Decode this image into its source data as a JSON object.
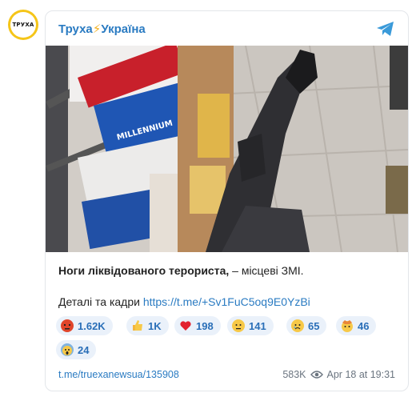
{
  "channel": {
    "avatar_text": "ТРУХА",
    "name_part1": "Труха",
    "name_bolt": "⚡",
    "name_part2": "Україна",
    "brand_color": "#2a7bc2",
    "avatar_color": "#f5c518"
  },
  "message": {
    "bold_text": "Ноги ліквідованого терориста,",
    "rest_text": " – місцеві ЗМІ.",
    "details_text": "Деталі та кадри ",
    "details_link": "https://t.me/+Sv1FuC5oq9E0YzBi"
  },
  "photo": {
    "box_brand": "MILLENNIUM"
  },
  "reactions": [
    {
      "icon": "angry-face-icon",
      "count": "1.62K"
    },
    {
      "icon": "thumbs-up-icon",
      "count": "1K"
    },
    {
      "icon": "red-heart-icon",
      "count": "198"
    },
    {
      "icon": "face-with-raised-eyebrow-icon",
      "count": "141"
    },
    {
      "icon": "crying-face-icon",
      "count": "65"
    },
    {
      "icon": "exploding-head-icon",
      "count": "46"
    },
    {
      "icon": "screaming-face-icon",
      "count": "24"
    }
  ],
  "footer": {
    "post_link": "t.me/truexanewsua/135908",
    "views": "583K",
    "date": "Apr 18 at 19:31"
  }
}
